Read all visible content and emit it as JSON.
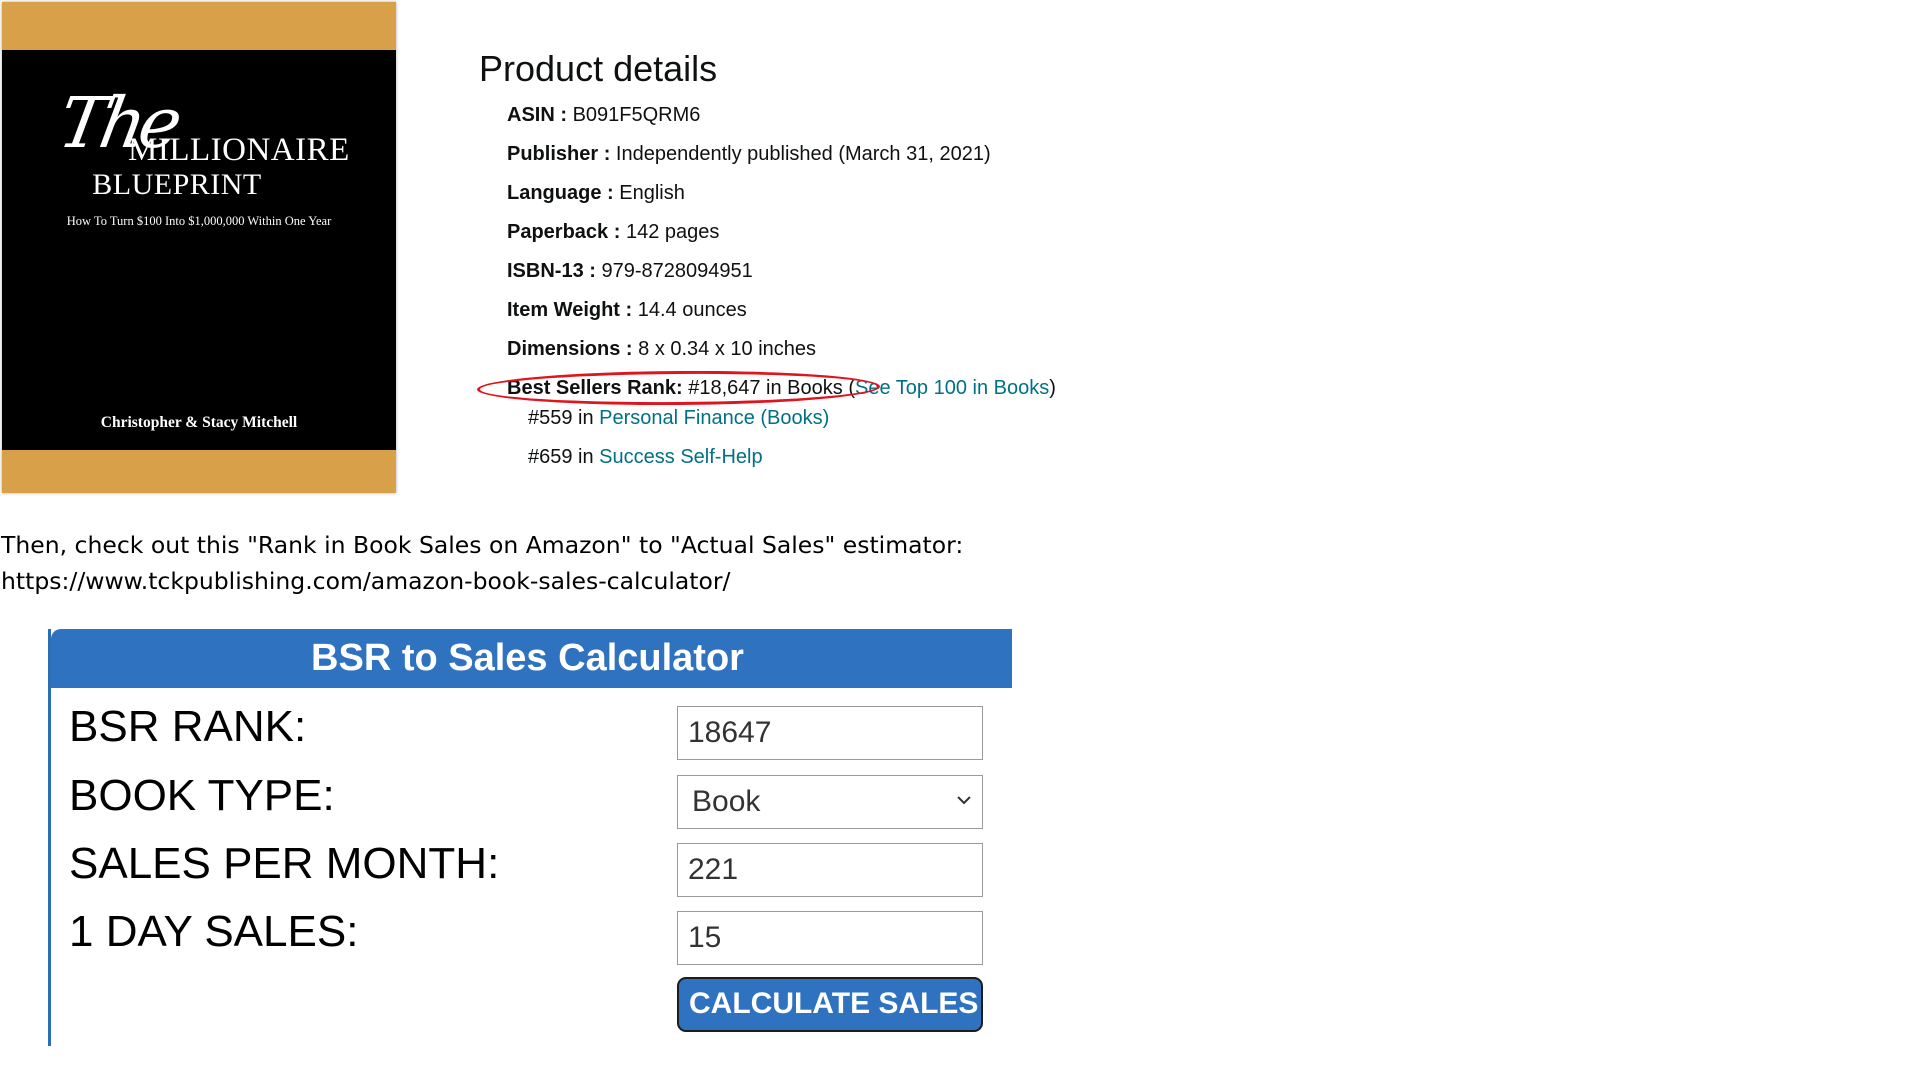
{
  "book_cover": {
    "script_title": "The",
    "title_line1": "MILLIONAIRE",
    "title_line2": "BLUEPRINT",
    "subtitle": "How To Turn $100 Into $1,000,000 Within One Year",
    "authors": "Christopher & Stacy Mitchell",
    "accent_color": "#d9a04a"
  },
  "product_details": {
    "heading": "Product details",
    "rows": [
      {
        "label": "ASIN :",
        "value": "B091F5QRM6"
      },
      {
        "label": "Publisher :",
        "value": "Independently published (March 31, 2021)"
      },
      {
        "label": "Language :",
        "value": "English"
      },
      {
        "label": "Paperback :",
        "value": "142 pages"
      },
      {
        "label": "ISBN-13 :",
        "value": "979-8728094951"
      },
      {
        "label": "Item Weight :",
        "value": "14.4 ounces"
      },
      {
        "label": "Dimensions :",
        "value": "8 x 0.34 x 10 inches"
      }
    ],
    "rank": {
      "label": "Best Sellers Rank:",
      "value": "#18,647 in Books",
      "open_paren": " (",
      "link": "See Top 100 in Books",
      "close_paren": ")",
      "sub_ranks": [
        {
          "rank": "#559 in ",
          "category": "Personal Finance (Books)"
        },
        {
          "rank": "#659 in ",
          "category": "Success Self-Help"
        }
      ]
    },
    "highlight_color": "#e0141e",
    "link_color": "#007185"
  },
  "note": {
    "line1": "Then, check out this \"Rank in Book Sales on Amazon\" to \"Actual Sales\" estimator:",
    "line2": "https://www.tckpublishing.com/amazon-book-sales-calculator/"
  },
  "calculator": {
    "title": "BSR to Sales Calculator",
    "bsr_rank_label": "BSR RANK:",
    "bsr_rank_value": "18647",
    "book_type_label": "BOOK TYPE:",
    "book_type_value": "Book",
    "sales_per_month_label": "SALES PER MONTH:",
    "sales_per_month_value": "221",
    "one_day_sales_label": "1 DAY SALES:",
    "one_day_sales_value": "15",
    "button_label": "CALCULATE SALES",
    "brand_color": "#2f72c0"
  }
}
